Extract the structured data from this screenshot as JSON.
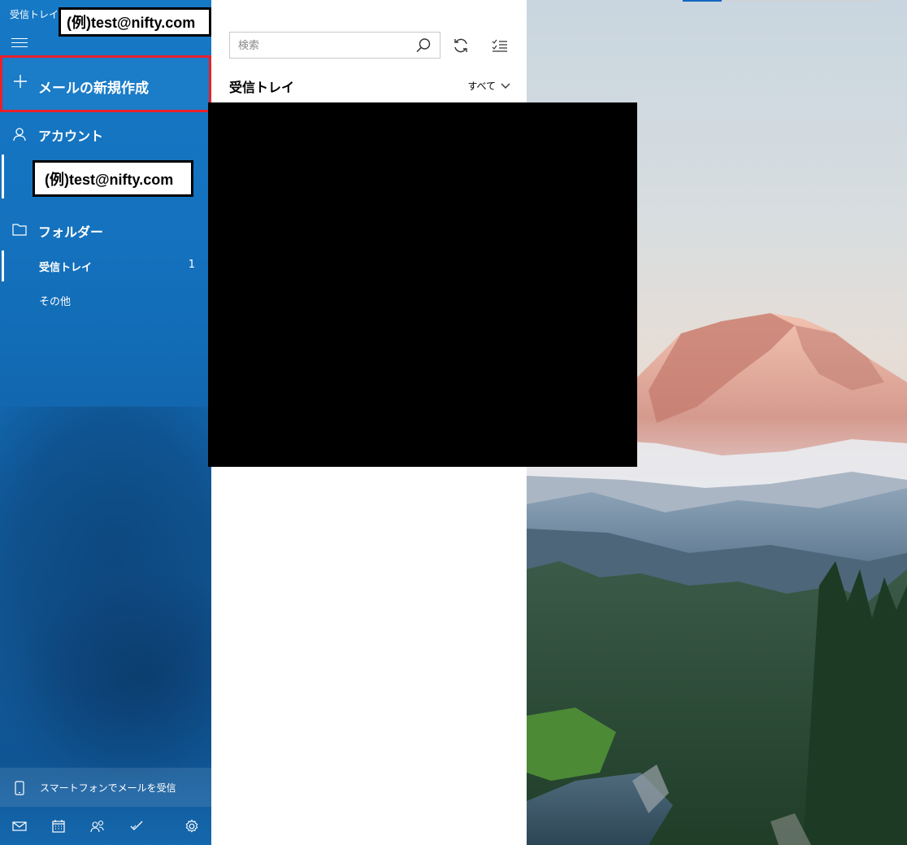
{
  "window": {
    "title": "受信トレイ - "
  },
  "account_email": "(例)test@nifty.com",
  "sidebar": {
    "new_mail_label": "メールの新規作成",
    "accounts_label": "アカウント",
    "account_item": "(例)test@nifty.com",
    "folders_label": "フォルダー",
    "folders": [
      {
        "label": "受信トレイ",
        "count": "1",
        "selected": true
      },
      {
        "label": "その他",
        "count": "",
        "selected": false
      }
    ],
    "phone_promo": "スマートフォンでメールを受信",
    "bottom_icons": [
      "mail-icon",
      "calendar-icon",
      "people-icon",
      "todo-icon",
      "settings-icon"
    ],
    "accent_color": "#1679c6",
    "highlight_color": "#e8202a"
  },
  "message_list": {
    "search_placeholder": "検索",
    "title": "受信トレイ",
    "filter_label": "すべて",
    "toolbar_icons": [
      "sync-icon",
      "select-mode-icon"
    ]
  }
}
